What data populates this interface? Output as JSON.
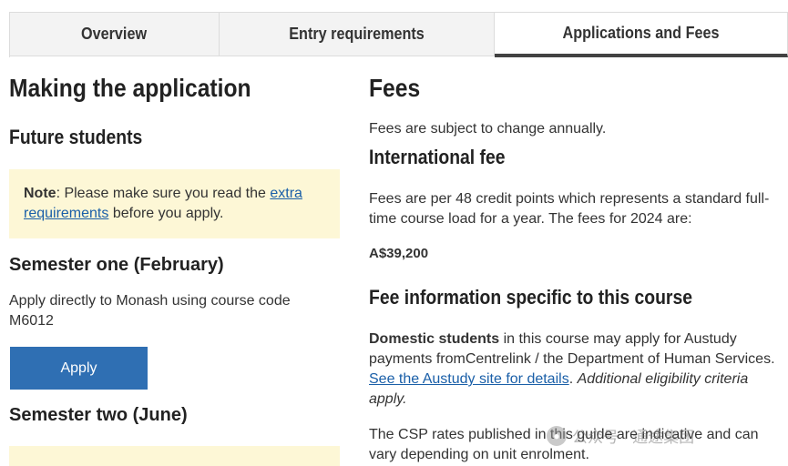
{
  "tabs": [
    {
      "label": "Overview",
      "active": false
    },
    {
      "label": "Entry requirements",
      "active": false
    },
    {
      "label": "Applications and Fees",
      "active": true
    }
  ],
  "left": {
    "heading": "Making the application",
    "subheading": "Future students",
    "note": {
      "label": "Note",
      "text_before": ": Please make sure you read the ",
      "link": "extra requirements",
      "text_after": " before you apply."
    },
    "semester_one": {
      "title": "Semester one (February)",
      "text": "Apply directly to Monash using course code M6012",
      "button": "Apply"
    },
    "semester_two": {
      "title": "Semester two (June)"
    }
  },
  "right": {
    "heading": "Fees",
    "intro": "Fees are subject to change annually.",
    "international": {
      "title": "International fee",
      "text": "Fees are per 48 credit points which represents a standard full-time course load for a year. The fees for 2024 are:",
      "amount": "A$39,200"
    },
    "specific": {
      "title": "Fee information specific to this course",
      "domestic_label": "Domestic students",
      "domestic_text": " in this course may apply for Austudy payments fromCentrelink / the Department of Human Services. ",
      "link": "See the Austudy site for details",
      "italic": "Additional eligibility criteria apply.",
      "csp_text": "The CSP rates published in this guide are indicative and can vary depending on unit enrolment."
    }
  },
  "watermark": {
    "text": "公众号 · 通途集团"
  },
  "colors": {
    "accent_blue": "#2f6fb3",
    "link_blue": "#1a5fa8",
    "note_bg": "#fdf7d6",
    "active_tab_border": "#424242"
  }
}
